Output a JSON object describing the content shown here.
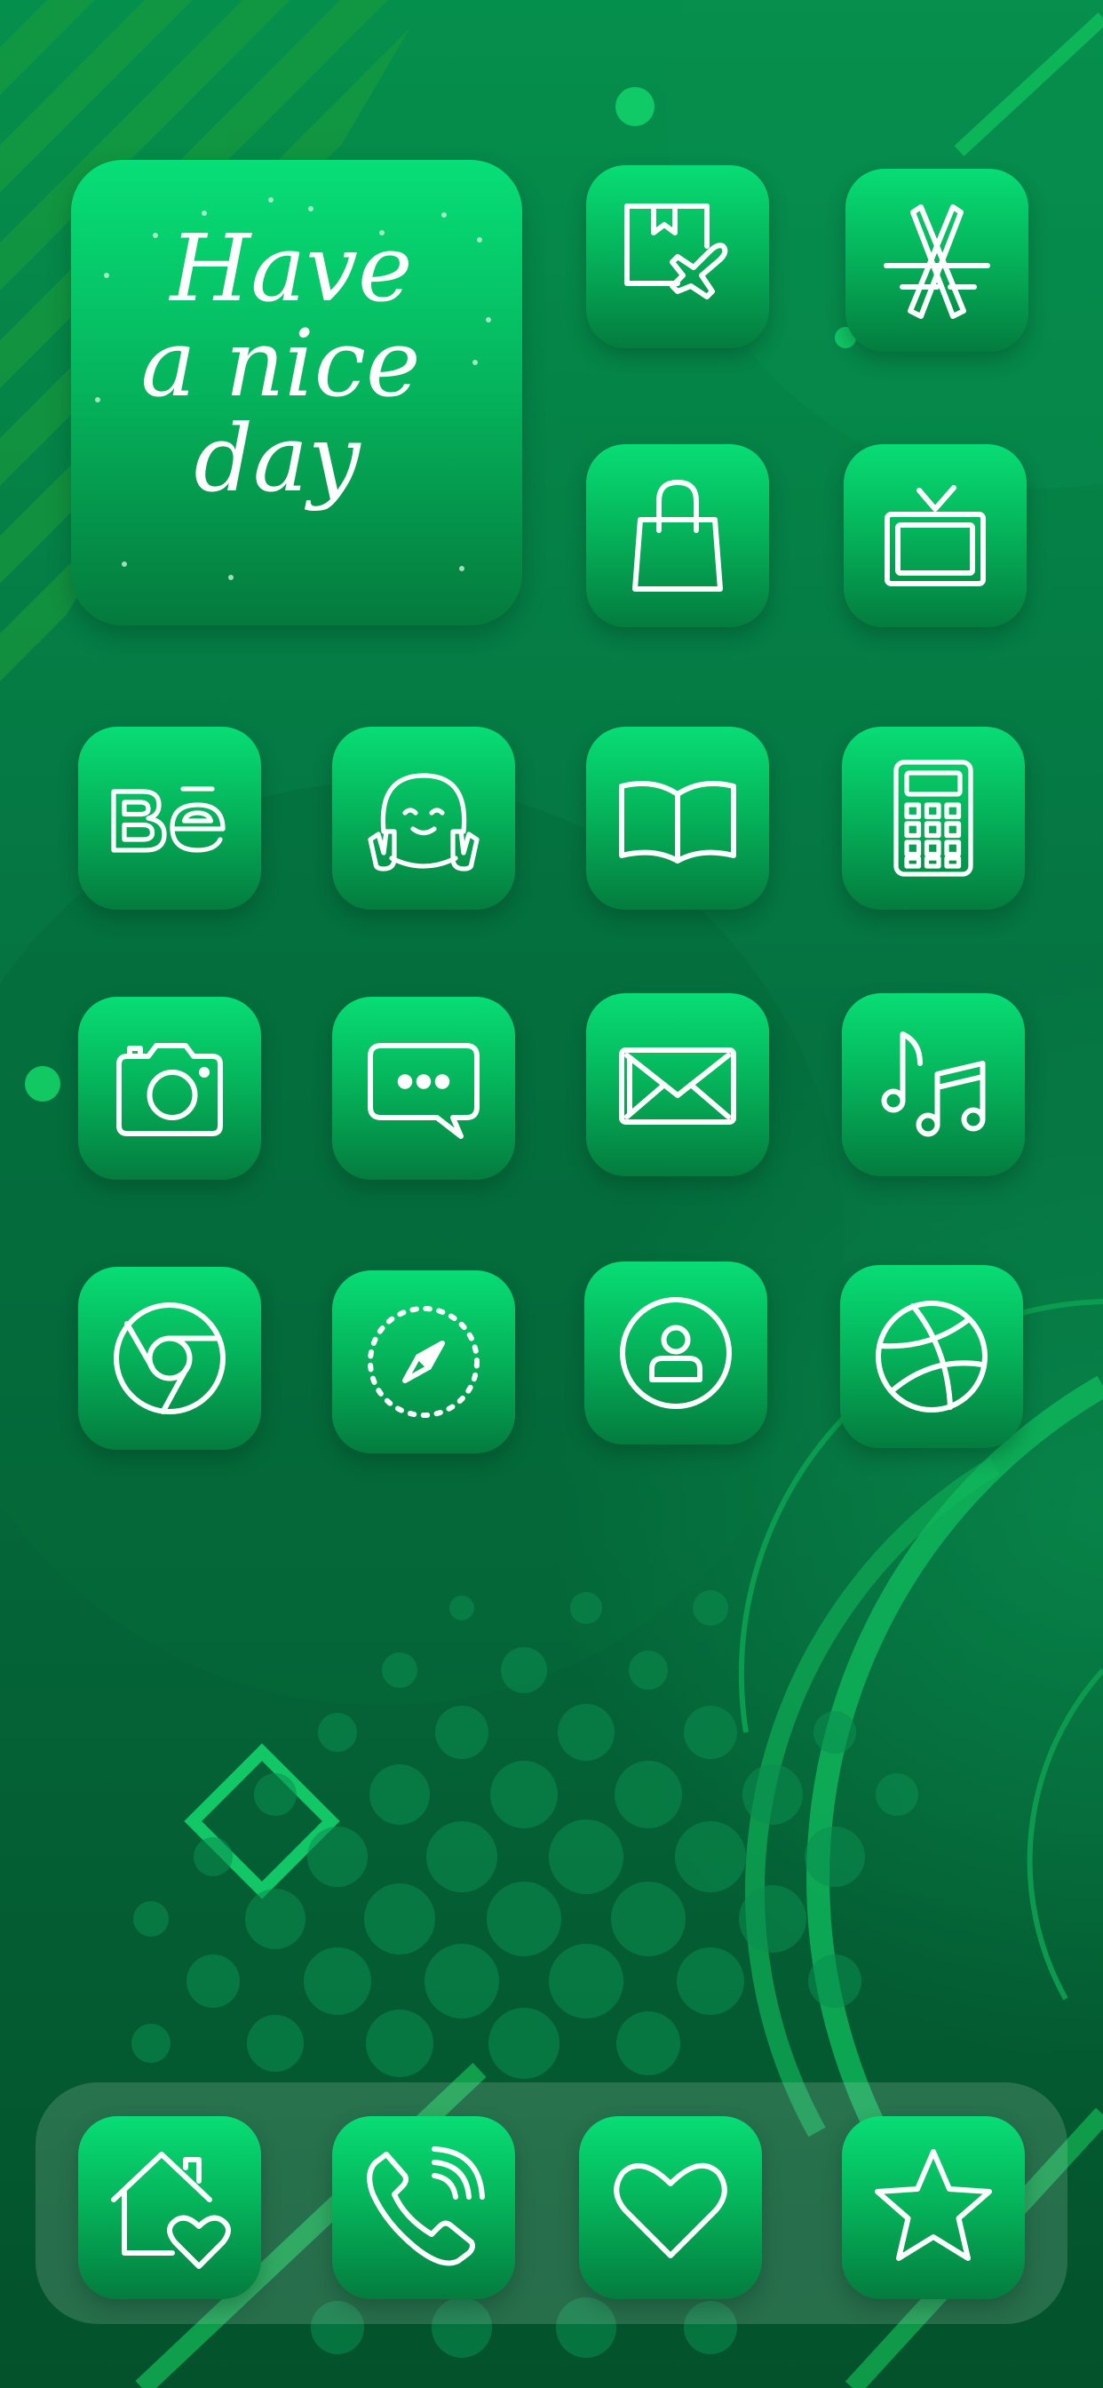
{
  "screen": {
    "background": "#05753f",
    "accent": "#08dd75",
    "glyph_color": "#ffffff"
  },
  "widget": {
    "lines": [
      "Have",
      "a nice",
      "day"
    ]
  },
  "apps": [
    {
      "id": "delivery",
      "icon": "package-airplane-icon"
    },
    {
      "id": "app-store",
      "icon": "app-store-icon"
    },
    {
      "id": "shopping",
      "icon": "shopping-bag-icon"
    },
    {
      "id": "tv",
      "icon": "tv-icon"
    },
    {
      "id": "behance",
      "icon": "behance-icon"
    },
    {
      "id": "social",
      "icon": "smiley-peace-icon"
    },
    {
      "id": "books",
      "icon": "open-book-icon"
    },
    {
      "id": "calculator",
      "icon": "calculator-icon"
    },
    {
      "id": "camera",
      "icon": "camera-icon"
    },
    {
      "id": "messages",
      "icon": "chat-bubble-icon"
    },
    {
      "id": "mail",
      "icon": "envelope-icon"
    },
    {
      "id": "music",
      "icon": "music-notes-icon"
    },
    {
      "id": "chrome",
      "icon": "chrome-icon"
    },
    {
      "id": "safari",
      "icon": "compass-icon"
    },
    {
      "id": "contacts",
      "icon": "person-circle-icon"
    },
    {
      "id": "dribbble",
      "icon": "basketball-icon"
    }
  ],
  "dock": [
    {
      "id": "home",
      "icon": "house-heart-icon"
    },
    {
      "id": "phone",
      "icon": "phone-icon"
    },
    {
      "id": "favorites",
      "icon": "heart-icon"
    },
    {
      "id": "starred",
      "icon": "star-icon"
    }
  ]
}
